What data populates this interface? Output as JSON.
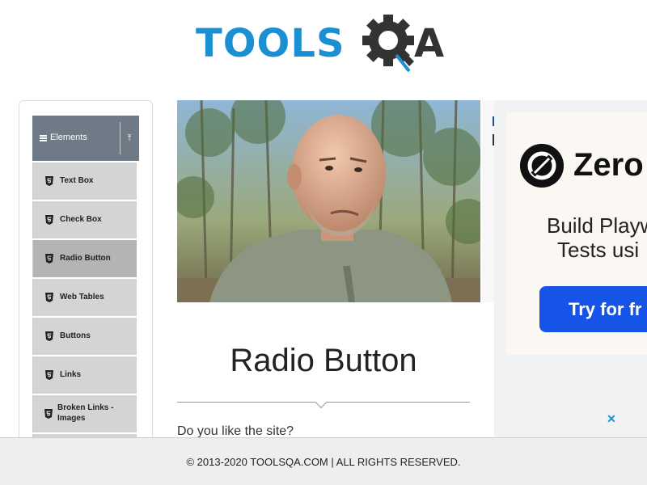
{
  "header": {
    "logo_text": "TOOLS",
    "logo_text_end": "A"
  },
  "sidebar": {
    "group": {
      "label": "Elements",
      "collapse_icon": "arrow-up-icon",
      "menu_icon": "hamburger-icon"
    },
    "items": [
      {
        "label": "Text Box",
        "active": false
      },
      {
        "label": "Check Box",
        "active": false
      },
      {
        "label": "Radio Button",
        "active": true
      },
      {
        "label": "Web Tables",
        "active": false
      },
      {
        "label": "Buttons",
        "active": false
      },
      {
        "label": "Links",
        "active": false
      },
      {
        "label": "Broken Links - Images",
        "active": false
      }
    ],
    "item_icon": "html5-icon"
  },
  "main": {
    "title": "Radio Button",
    "question": "Do you like the site?"
  },
  "ad": {
    "brand": "Zero",
    "line1": "Build Playw",
    "line2": "Tests usi",
    "cta": "Try for fr",
    "close_glyph": "✕"
  },
  "footer": {
    "text": "© 2013-2020 TOOLSQA.COM | ALL RIGHTS RESERVED."
  },
  "colors": {
    "brand_blue": "#1a8fd1",
    "sidebar_header": "#6e7a86",
    "menu_item": "#d4d4d4",
    "menu_item_active": "#b4b4b4",
    "ad_button": "#1554e6"
  }
}
